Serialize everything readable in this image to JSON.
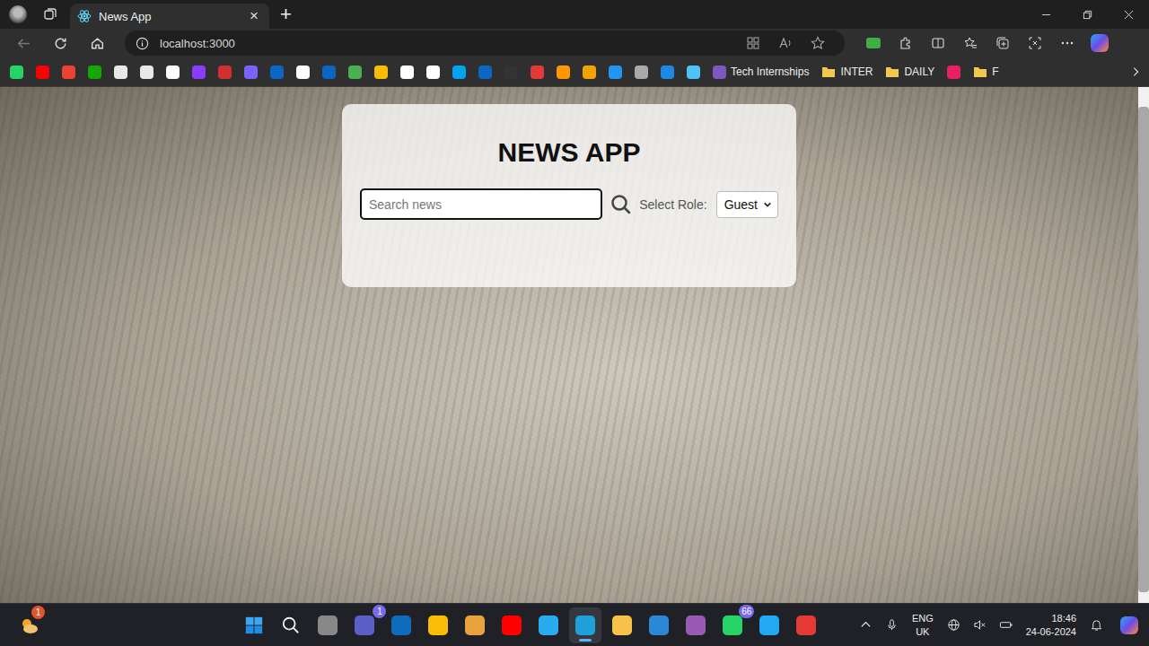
{
  "browser": {
    "tab": {
      "title": "News App",
      "close": "×",
      "selected": true
    },
    "new_tab": "+",
    "address": "localhost:3000",
    "back_disabled": true
  },
  "bookmarks": [
    {
      "label": "Tech Internships",
      "kind": "link"
    },
    {
      "label": "INTER",
      "kind": "folder"
    },
    {
      "label": "DAILY",
      "kind": "folder"
    },
    {
      "label": "F",
      "kind": "folder"
    }
  ],
  "page": {
    "title": "NEWS APP",
    "search": {
      "placeholder": "Search news",
      "focused": true
    },
    "role": {
      "label": "Select Role:",
      "value": "Guest"
    }
  },
  "taskbar": {
    "widgets_badge": "1",
    "apps": [
      {
        "active": false
      },
      {
        "active": false
      },
      {
        "active": false
      },
      {
        "badge": "1",
        "active": false
      },
      {
        "active": false
      },
      {
        "active": false
      },
      {
        "active": false
      },
      {
        "active": false
      },
      {
        "active": false
      },
      {
        "active": true
      },
      {
        "active": false
      },
      {
        "active": false
      },
      {
        "active": false
      },
      {
        "badge": "66",
        "active": false
      },
      {
        "active": false
      },
      {
        "active": false
      }
    ],
    "tray": {
      "language": "ENG",
      "region": "UK",
      "time": "18:46",
      "date": "24-06-2024"
    }
  }
}
